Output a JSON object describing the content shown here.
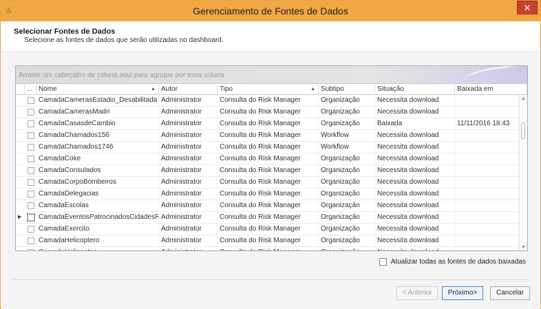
{
  "window": {
    "title": "Gerenciamento de Fontes de Dados",
    "close_label": "✕",
    "app_icon": "◬",
    "accent_color": "#f0a844"
  },
  "header": {
    "title": "Selecionar Fontes de Dados",
    "subtitle": "Selecione as fontes de dados que serão utilizadas no dashboard."
  },
  "grid": {
    "group_panel_text": "Arraste um cabeçalho de coluna aqui para agrupar por essa coluna",
    "columns": {
      "select": "...",
      "nome": "Nome",
      "autor": "Autor",
      "tipo": "Tipo",
      "subtipo": "Subtipo",
      "situacao": "Situação",
      "baixada": "Baixada em"
    },
    "sort_indicator": "▲",
    "focus_indicator": "▶",
    "rows": [
      {
        "nome": "CamadaCamerasEstadio_Desabilitada",
        "autor": "Administrator",
        "tipo": "Consulta do Risk Manager",
        "subtipo": "Organização",
        "situacao": "Necessita download",
        "baixada": ""
      },
      {
        "nome": "CamadaCamerasMadri",
        "autor": "Administrator",
        "tipo": "Consulta do Risk Manager",
        "subtipo": "Organização",
        "situacao": "Necessita download",
        "baixada": ""
      },
      {
        "nome": "CamadaCasasdeCambio",
        "autor": "Administrator",
        "tipo": "Consulta do Risk Manager",
        "subtipo": "Organização",
        "situacao": "Baixada",
        "baixada": "11/11/2016 18:43"
      },
      {
        "nome": "CamadaChamados156",
        "autor": "Administrator",
        "tipo": "Consulta do Risk Manager",
        "subtipo": "Workflow",
        "situacao": "Necessita download",
        "baixada": ""
      },
      {
        "nome": "CamadaChamados1746",
        "autor": "Administrator",
        "tipo": "Consulta do Risk Manager",
        "subtipo": "Workflow",
        "situacao": "Necessita download",
        "baixada": ""
      },
      {
        "nome": "CamadaCoke",
        "autor": "Administrator",
        "tipo": "Consulta do Risk Manager",
        "subtipo": "Organização",
        "situacao": "Necessita download",
        "baixada": ""
      },
      {
        "nome": "CamadaConsulados",
        "autor": "Administrator",
        "tipo": "Consulta do Risk Manager",
        "subtipo": "Organização",
        "situacao": "Necessita download",
        "baixada": ""
      },
      {
        "nome": "CamadaCorpoBombeiros",
        "autor": "Administrator",
        "tipo": "Consulta do Risk Manager",
        "subtipo": "Organização",
        "situacao": "Necessita download",
        "baixada": ""
      },
      {
        "nome": "CamadaDelegacias",
        "autor": "Administrator",
        "tipo": "Consulta do Risk Manager",
        "subtipo": "Organização",
        "situacao": "Necessita download",
        "baixada": ""
      },
      {
        "nome": "CamadaEscolas",
        "autor": "Administrator",
        "tipo": "Consulta do Risk Manager",
        "subtipo": "Organização",
        "situacao": "Necessita download",
        "baixada": ""
      },
      {
        "nome": "CamadaEventosPatrocinadosCidadesReve...",
        "autor": "Administrator",
        "tipo": "Consulta do Risk Manager",
        "subtipo": "Organização",
        "situacao": "Necessita download",
        "baixada": "",
        "focused": true
      },
      {
        "nome": "CamadaExercito",
        "autor": "Administrator",
        "tipo": "Consulta do Risk Manager",
        "subtipo": "Organização",
        "situacao": "Necessita download",
        "baixada": ""
      },
      {
        "nome": "CamadaHelicoptero",
        "autor": "Administrator",
        "tipo": "Consulta do Risk Manager",
        "subtipo": "Organização",
        "situacao": "Necessita download",
        "baixada": ""
      },
      {
        "nome": "CamadaHelipontos",
        "autor": "Administrator",
        "tipo": "Consulta do Risk Manager",
        "subtipo": "Organização",
        "situacao": "Necessita download",
        "baixada": ""
      }
    ]
  },
  "options": {
    "update_all_label": "Atualizar todas as fontes de dados baixadas"
  },
  "buttons": {
    "back": "< Anterior",
    "next": "Próximo>",
    "cancel": "Cancelar"
  }
}
